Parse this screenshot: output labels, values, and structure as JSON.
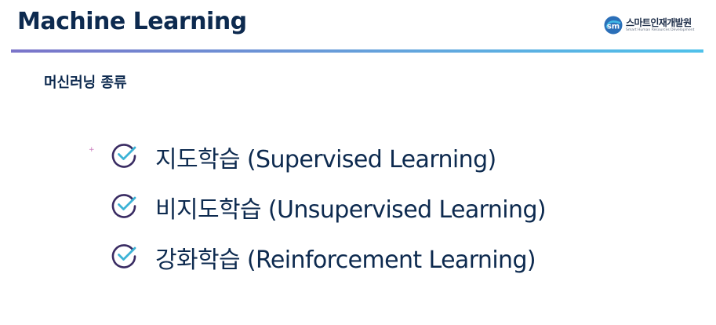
{
  "header": {
    "title": "Machine Learning",
    "logo": {
      "name": "스마트인재개발원",
      "subtitle": "Smart Human Resources Development",
      "icon": "sm-logo-icon",
      "colors": [
        "#2b6fb8",
        "#40b8e6"
      ]
    },
    "rule_colors": [
      "#7b74c9",
      "#64a3dc",
      "#4fc1ea"
    ]
  },
  "section": {
    "heading": "머신러닝 종류"
  },
  "bullets": [
    {
      "icon": "check-circle-icon",
      "text": "지도학습 (Supervised Learning)"
    },
    {
      "icon": "check-circle-icon",
      "text": "비지도학습 (Unsupervised Learning)"
    },
    {
      "icon": "check-circle-icon",
      "text": "강화학습 (Reinforcement Learning)"
    }
  ],
  "colors": {
    "text": "#0d2a4f",
    "check_ring": "#3a2c63",
    "check_mark": "#3bb3d6"
  }
}
